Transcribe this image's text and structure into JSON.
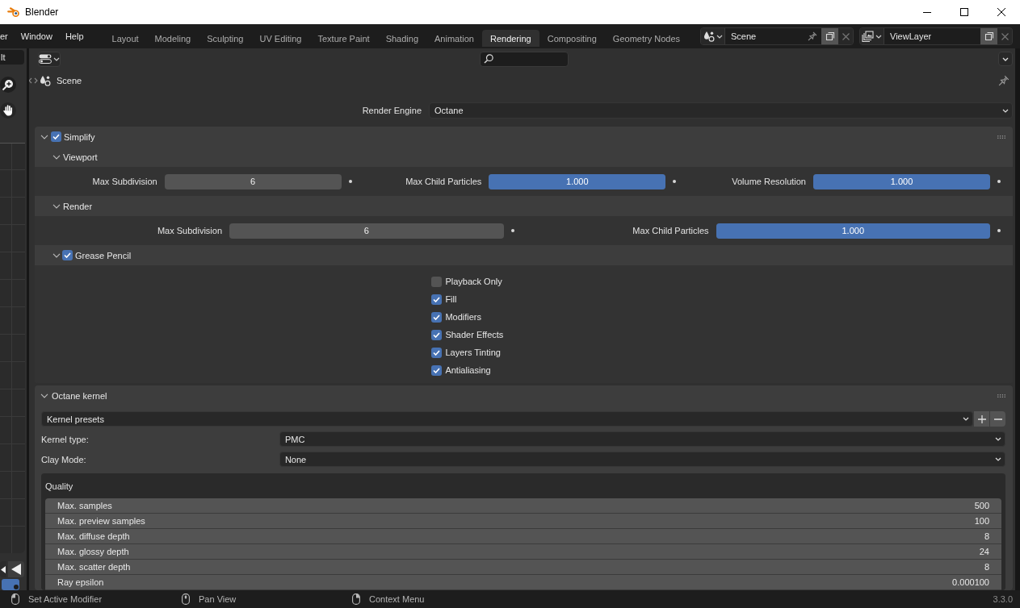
{
  "window": {
    "title": "Blender"
  },
  "menu_bar": {
    "menus": [
      "er",
      "Window",
      "Help"
    ]
  },
  "workspace_tabs": [
    {
      "label": "Layout",
      "selected": false
    },
    {
      "label": "Modeling",
      "selected": false
    },
    {
      "label": "Sculpting",
      "selected": false
    },
    {
      "label": "UV Editing",
      "selected": false
    },
    {
      "label": "Texture Paint",
      "selected": false
    },
    {
      "label": "Shading",
      "selected": false
    },
    {
      "label": "Animation",
      "selected": false
    },
    {
      "label": "Rendering",
      "selected": true
    },
    {
      "label": "Compositing",
      "selected": false
    },
    {
      "label": "Geometry Nodes",
      "selected": false
    }
  ],
  "scene_selector": {
    "value": "Scene"
  },
  "view_layer_selector": {
    "value": "ViewLayer"
  },
  "side_editor": {
    "field_text": "lt"
  },
  "properties": {
    "context": "Scene",
    "render_engine": {
      "label": "Render Engine",
      "value": "Octane"
    },
    "simplify_panel": {
      "title": "Simplify",
      "expanded": true,
      "checked": true,
      "subpanels": [
        {
          "title": "Viewport",
          "expanded": true,
          "fields": [
            {
              "label": "Max Subdivision",
              "value": "6",
              "kind": "number"
            },
            {
              "label": "Max Child Particles",
              "value": "1.000",
              "kind": "slider",
              "level": 1
            },
            {
              "label": "Volume Resolution",
              "value": "1.000",
              "kind": "slider",
              "level": 1
            }
          ]
        },
        {
          "title": "Render",
          "expanded": true,
          "fields": [
            {
              "label": "Max Subdivision",
              "value": "6",
              "kind": "number"
            },
            {
              "label": "Max Child Particles",
              "value": "1.000",
              "kind": "slider",
              "level": 1
            }
          ]
        },
        {
          "title": "Grease Pencil",
          "expanded": true,
          "checked": true,
          "options": [
            {
              "label": "Playback Only",
              "checked": false
            },
            {
              "label": "Fill",
              "checked": true
            },
            {
              "label": "Modifiers",
              "checked": true
            },
            {
              "label": "Shader Effects",
              "checked": true
            },
            {
              "label": "Layers Tinting",
              "checked": true
            },
            {
              "label": "Antialiasing",
              "checked": true
            }
          ]
        }
      ]
    },
    "kernel_panel": {
      "title": "Octane kernel",
      "expanded": true,
      "presets": {
        "label": "Kernel presets"
      },
      "dropdowns": [
        {
          "label": "Kernel type:",
          "value": "PMC"
        },
        {
          "label": "Clay Mode:",
          "value": "None"
        }
      ],
      "quality": {
        "title": "Quality",
        "rows": [
          {
            "label": "Max. samples",
            "value": "500"
          },
          {
            "label": "Max. preview samples",
            "value": "100"
          },
          {
            "label": "Max. diffuse depth",
            "value": "8"
          },
          {
            "label": "Max. glossy depth",
            "value": "24"
          },
          {
            "label": "Max. scatter depth",
            "value": "8"
          },
          {
            "label": "Ray epsilon",
            "value": "0.000100"
          }
        ]
      }
    }
  },
  "status_bar": {
    "hints": [
      {
        "kind": "left",
        "label": "Set Active Modifier"
      },
      {
        "kind": "middle",
        "label": "Pan View"
      },
      {
        "kind": "right",
        "label": "Context Menu"
      }
    ],
    "version": "3.3.0"
  }
}
